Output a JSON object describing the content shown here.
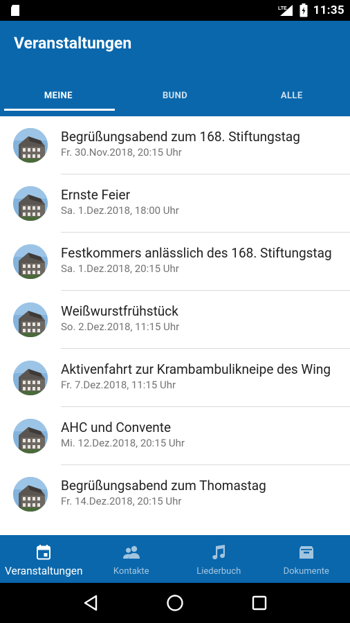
{
  "status_bar": {
    "time": "11:35",
    "network": "LTE",
    "icons": [
      "sd-card-icon",
      "lte-signal-icon",
      "battery-icon"
    ]
  },
  "app_bar": {
    "title": "Veranstaltungen",
    "tabs": [
      {
        "label": "MEINE",
        "active": true
      },
      {
        "label": "BUND",
        "active": false
      },
      {
        "label": "ALLE",
        "active": false
      }
    ]
  },
  "events": [
    {
      "title": "Begrüßungsabend zum 168. Stiftungstag",
      "date": "Fr. 30.Nov.2018, 20:15 Uhr"
    },
    {
      "title": "Ernste Feier",
      "date": "Sa. 1.Dez.2018, 18:00 Uhr"
    },
    {
      "title": "Festkommers anlässlich des 168. Stiftungstag",
      "date": "Sa. 1.Dez.2018, 20:15 Uhr"
    },
    {
      "title": "Weißwurstfrühstück",
      "date": "So. 2.Dez.2018, 11:15 Uhr"
    },
    {
      "title": "Aktivenfahrt zur Krambambulikneipe des Wing",
      "date": "Fr. 7.Dez.2018, 11:15 Uhr"
    },
    {
      "title": "AHC und Convente",
      "date": "Mi. 12.Dez.2018, 20:15 Uhr"
    },
    {
      "title": "Begrüßungsabend zum Thomastag",
      "date": "Fr. 14.Dez.2018, 20:15 Uhr"
    }
  ],
  "bottom_nav": [
    {
      "label": "Veranstaltungen",
      "icon": "calendar-icon",
      "active": true
    },
    {
      "label": "Kontakte",
      "icon": "contacts-icon",
      "active": false
    },
    {
      "label": "Liederbuch",
      "icon": "music-note-icon",
      "active": false
    },
    {
      "label": "Dokumente",
      "icon": "archive-icon",
      "active": false
    }
  ],
  "colors": {
    "primary": "#0a67ac",
    "text_primary": "#212121",
    "text_secondary": "#737373",
    "divider": "#dadada"
  }
}
